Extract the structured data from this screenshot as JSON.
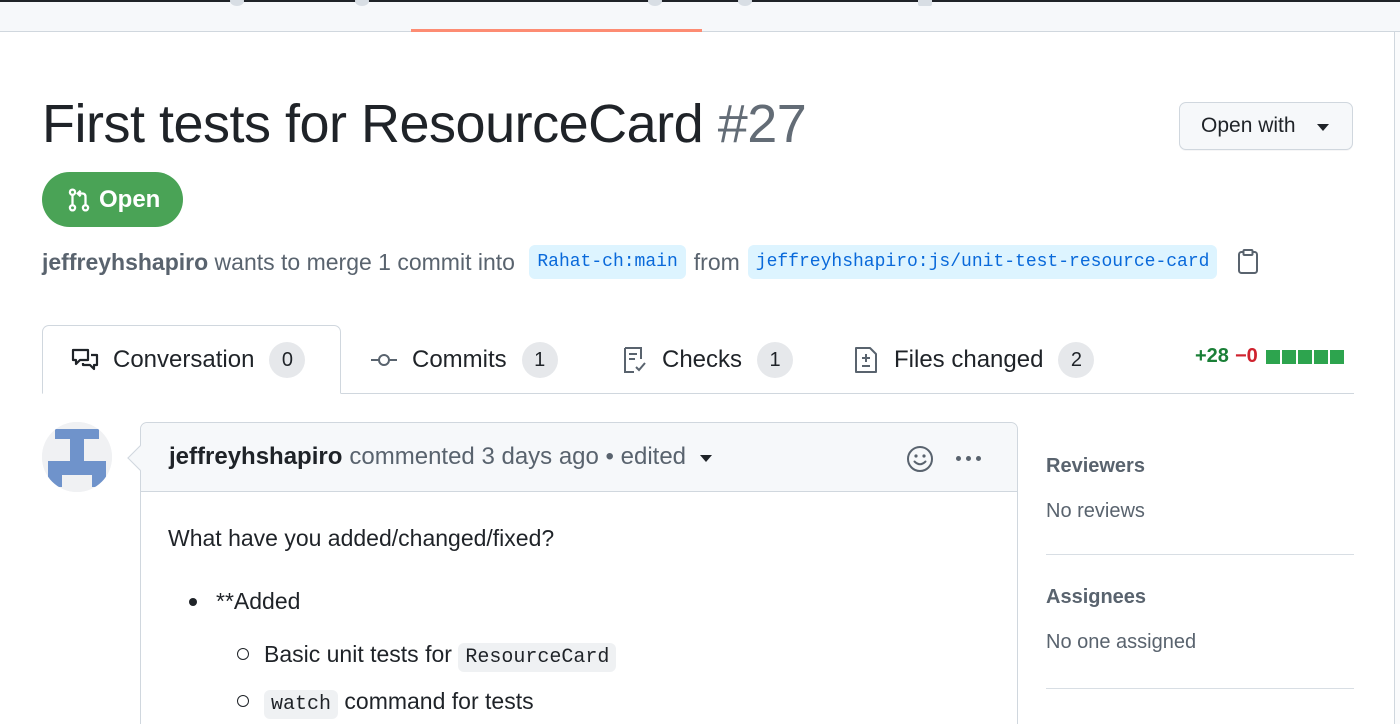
{
  "pull_request": {
    "title": "First tests for ResourceCard",
    "number": "#27",
    "state": "Open",
    "author": "jeffreyhshapiro",
    "merge_text": "wants to merge 1 commit into",
    "base_branch": "Rahat-ch:main",
    "from_text": "from",
    "head_branch": "jeffreyhshapiro:js/unit-test-resource-card"
  },
  "open_with": {
    "label": "Open with"
  },
  "tabs": [
    {
      "label": "Conversation",
      "count": "0",
      "icon": "comment-discussion-icon"
    },
    {
      "label": "Commits",
      "count": "1",
      "icon": "git-commit-icon"
    },
    {
      "label": "Checks",
      "count": "1",
      "icon": "checklist-icon"
    },
    {
      "label": "Files changed",
      "count": "2",
      "icon": "file-diff-icon"
    }
  ],
  "diffstat": {
    "additions": "+28",
    "deletions": "−0",
    "blocks_green": 5
  },
  "comment": {
    "author": "jeffreyhshapiro",
    "action": "commented",
    "time": "3 days ago",
    "edited": "• edited",
    "body_question": "What have you added/changed/fixed?",
    "bullet_added": "**Added",
    "sub_items": [
      {
        "text": "Basic unit tests for ",
        "code": "ResourceCard"
      },
      {
        "code": "watch",
        "text": " command for tests"
      }
    ]
  },
  "sidebar": {
    "reviewers_heading": "Reviewers",
    "reviewers_value": "No reviews",
    "assignees_heading": "Assignees",
    "assignees_value": "No one assigned"
  },
  "colors": {
    "open_badge": "#4aa356",
    "branch_bg": "#ddf4ff",
    "branch_text": "#0969da",
    "additions": "#1a7f37",
    "deletions": "#cf222e",
    "nav_underline": "#fd8c73"
  }
}
